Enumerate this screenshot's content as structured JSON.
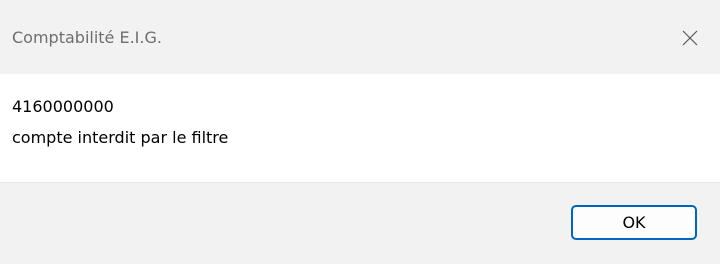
{
  "window": {
    "title": "Comptabilité E.I.G.",
    "close_icon": "close-icon"
  },
  "message": {
    "line1": "4160000000",
    "line2": "compte interdit par le filtre"
  },
  "buttons": {
    "ok_label": "OK"
  },
  "colors": {
    "titlebar_bg": "#f2f2f2",
    "content_bg": "#ffffff",
    "footer_bg": "#f2f2f2",
    "accent": "#0067c0"
  }
}
